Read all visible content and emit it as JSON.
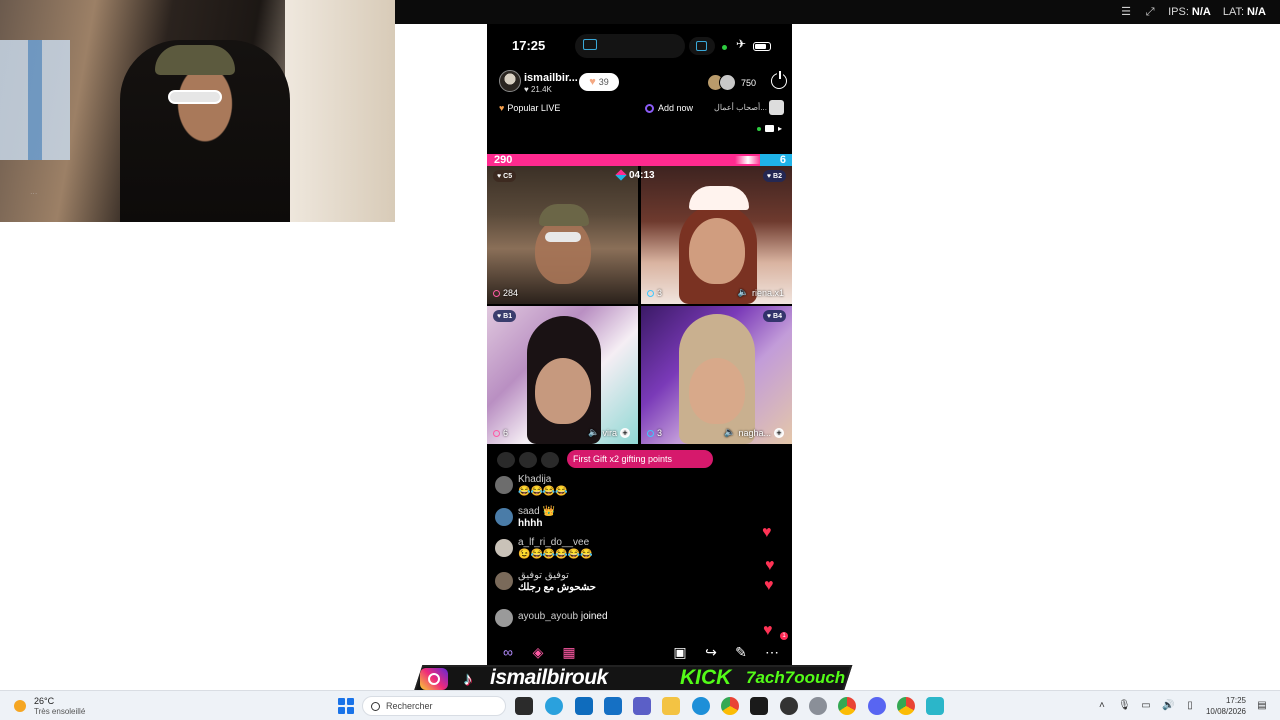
{
  "mirror_bar": {
    "ips_label": "IPS:",
    "ips_value": "N/A",
    "lat_label": "LAT:",
    "lat_value": "N/A"
  },
  "webcam": {
    "overlay_text": "..."
  },
  "phone": {
    "status": {
      "time": "17:25"
    },
    "host": {
      "name": "ismailbir...",
      "likes": "21.4K",
      "follow_count": "39",
      "viewers": "750"
    },
    "sub": {
      "popular": "Popular LIVE",
      "add_now": "Add now",
      "group_name": "أصحاب أعمال..."
    },
    "battle": {
      "left_score": "290",
      "right_score": "6",
      "timer": "04:13"
    },
    "tiles": [
      {
        "rank": "C5",
        "score": "284",
        "name": ""
      },
      {
        "rank": "B2",
        "score": "3",
        "name": "riena.x1"
      },
      {
        "rank": "B1",
        "score": "6",
        "name": "vira"
      },
      {
        "rank": "B4",
        "score": "3",
        "name": "nagha..."
      }
    ],
    "gift_banner": "First Gift x2 gifting points",
    "comments": [
      {
        "user": "Khadija",
        "message": "😂😂😂😂"
      },
      {
        "user": "saad 👑",
        "message": "hhhh"
      },
      {
        "user": "a_lf_ri_do__vee",
        "message": "😉😂😂😂😂😂"
      },
      {
        "user": "توفيق توفيق",
        "message": "حشحوش مع رجلك"
      }
    ],
    "joined": {
      "user": "ayoub_ayoub",
      "text": "joined"
    },
    "heart_badge": "1"
  },
  "branding": {
    "instagram_handle": "ismailbirouk",
    "kick_label": "KICK",
    "kick_handle": "7ach7oouch"
  },
  "taskbar": {
    "weather_temp": "26°C",
    "weather_cond": "Très ensoleillé",
    "search_placeholder": "Rechercher",
    "time": "17:25",
    "date": "10/08/2026"
  }
}
